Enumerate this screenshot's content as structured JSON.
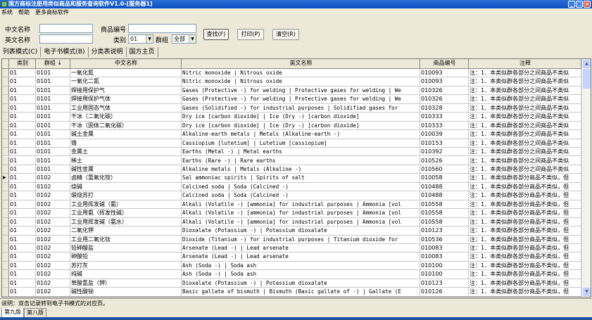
{
  "window": {
    "title": "国方商标注册用类似商品和服务查询软件V1.0-[服务器1]"
  },
  "menu": [
    "系统",
    "帮助",
    "更多商标软件"
  ],
  "form": {
    "cn_name_label": "中文名称",
    "cn_name_value": "",
    "en_name_label": "英文名称",
    "en_name_value": "",
    "goods_no_label": "商品编号",
    "goods_no_value": "",
    "class_label": "类别",
    "class_value": "01",
    "group_label": "群组",
    "group_value": "全部",
    "search_btn": "查找(F)",
    "print_btn": "打印(P)",
    "clear_btn": "清空(R)"
  },
  "tabs": [
    "列表模式(C)",
    "电子书模式(B)",
    "分类表说明",
    "国方主页"
  ],
  "grid": {
    "headers": [
      "类别",
      "群组 ↓",
      "中文名称",
      "英文名称",
      "商品编号",
      "注释"
    ],
    "selected_row": 12,
    "rows": [
      [
        "01",
        "0101",
        "一氧化氮",
        "Nitric monoxide | Nitrous oxide",
        "010093",
        "注：1．本类似群各部分之间商品不类似"
      ],
      [
        "01",
        "0101",
        "一氧化二氮",
        "Nitric monoxide | Nitrous oxide",
        "010093",
        "注：1．本类似群各部分之间商品不类似"
      ],
      [
        "01",
        "0101",
        "焊接用保护气",
        "Gases (Protective -) for welding | Protective gases for welding | We",
        "010326",
        "注：1．本类似群各部分之间商品不类似"
      ],
      [
        "01",
        "0101",
        "焊接用保护气体",
        "Gases (Protective -) for welding | Protective gases for welding | We",
        "010326",
        "注：1．本类似群各部分之间商品不类似"
      ],
      [
        "01",
        "0101",
        "工业用固态气体",
        "Gases (Solidified -) for industrial purposes | Solidified gases for",
        "010328",
        "注：1．本类似群各部分之间商品不类似"
      ],
      [
        "01",
        "0101",
        "干冰（二氧化碳）",
        "Dry ice [carbon dioxide] | Ice (Dry -) [carbon dioxide]",
        "010333",
        "注：1．本类似群各部分之间商品不类似"
      ],
      [
        "01",
        "0101",
        "干冰（固体二氧化碳）",
        "Dry ice [carbon dioxide] | Ice (Dry -) [carbon dioxide]",
        "010333",
        "注：1．本类似群各部分之间商品不类似"
      ],
      [
        "01",
        "0101",
        "碱土金属",
        "Alkaline-earth metals | Metals (Alkaline-earth -)",
        "010039",
        "注：1．本类似群各部分之间商品不类似"
      ],
      [
        "01",
        "0101",
        "镥",
        "Cassiopium [lutetium] | Lutetium [cassiopium]",
        "010153",
        "注：1．本类似群各部分之间商品不类似"
      ],
      [
        "01",
        "0101",
        "金属土",
        "Earths (Metal -) | Metal earths",
        "010392",
        "注：1．本类似群各部分之间商品不类似"
      ],
      [
        "01",
        "0101",
        "稀土",
        "Earths (Rare -) | Rare earths",
        "010526",
        "注：1．本类似群各部分之间商品不类似"
      ],
      [
        "01",
        "0101",
        "碱性金属",
        "Alkaline metals | Metals (Alkaline -)",
        "010560",
        "注：1．本类似群各部分之间商品不类似"
      ],
      [
        "01",
        "0102",
        "卤精（氢氧化铵）",
        "Sal ammoniac spirits | Spirits of salt",
        "010058",
        "注：1．本类似群各部分商品不类似，但"
      ],
      [
        "01",
        "0102",
        "烧碱",
        "Calcined soda | Soda (Calcined -)",
        "010488",
        "注：1．本类似群各部分商品不类似，但"
      ],
      [
        "01",
        "0102",
        "煅烧苏打",
        "Calcined soda | Soda (Calcined -)",
        "010488",
        "注：1．本类似群各部分商品不类似，但"
      ],
      [
        "01",
        "0102",
        "工业用挥发碱（氨）",
        "Alkali (Volatile -) [ammonia] for industrial purposes | Ammonia [vol",
        "010558",
        "注：1．本类似群各部分商品不类似，但"
      ],
      [
        "01",
        "0102",
        "工业用氨（挥发性碱）",
        "Alkali (Volatile -) [ammonia] for industrial purposes | Ammonia [vol",
        "010558",
        "注：1．本类似群各部分商品不类似，但"
      ],
      [
        "01",
        "0102",
        "工业用挥发碱（氨水）",
        "Alkali (Volatile -) [ammonia] for industrial purposes | Ammonia [vol",
        "010558",
        "注：1．本类似群各部分商品不类似，但"
      ],
      [
        "01",
        "0102",
        "二氧化钾",
        "Dioxalate (Potassium -) | Potassium dioxalate",
        "010123",
        "注：1．本类似群各部分商品不类似，但"
      ],
      [
        "01",
        "0102",
        "工业用二氧化钛",
        "Dioxide (Titanium -) for industrial purposes | Titanium dioxide for",
        "010536",
        "注：1．本类似群各部分商品不类似，但"
      ],
      [
        "01",
        "0102",
        "铅砷酸盐",
        "Arsenate (Lead -) | Lead arsenate",
        "010083",
        "注：1．本类似群各部分商品不类似，但"
      ],
      [
        "01",
        "0102",
        "砷酸铅",
        "Arsenate (Lead -) | Lead arsenate",
        "010083",
        "注：1．本类似群各部分商品不类似，但"
      ],
      [
        "01",
        "0102",
        "苏打灰",
        "Ash (Soda -) | Soda ash",
        "010100",
        "注：1．本类似群各部分商品不类似，但"
      ],
      [
        "01",
        "0102",
        "纯碱",
        "Ash (Soda -) | Soda ash",
        "010100",
        "注：1．本类似群各部分商品不类似，但"
      ],
      [
        "01",
        "0102",
        "草酸氢盐（钾）",
        "Dioxalate (Potassium -) | Potassium dioxalate",
        "010123",
        "注：1．本类似群各部分商品不类似，但"
      ],
      [
        "01",
        "0102",
        "碱性酸铋",
        "Basic gallate of bismuth | Bismuth (Basic gallate of -) | Gallate (E",
        "010126",
        "注：1．本类似群各部分商品不类似，但"
      ]
    ]
  },
  "status": "说明：双击记录转到电子书模式的对应页。",
  "bottom_tabs": [
    "第九版",
    "第八版"
  ]
}
